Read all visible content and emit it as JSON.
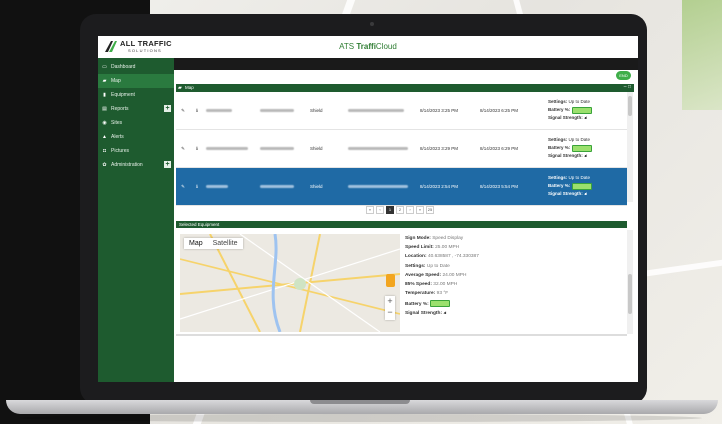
{
  "header": {
    "logo_text": "ALL TRAFFIC",
    "logo_sub": "SOLUTIONS",
    "app_title_prefix": "ATS ",
    "app_title_bold": "Traffi",
    "app_title_suffix": "Cloud"
  },
  "sidebar": {
    "items": [
      {
        "label": "Dashboard",
        "icon": "monitor-icon",
        "glyph": "▭"
      },
      {
        "label": "Map",
        "icon": "map-icon",
        "glyph": "▰",
        "active": true
      },
      {
        "label": "Equipment",
        "icon": "equipment-icon",
        "glyph": "▮"
      },
      {
        "label": "Reports",
        "icon": "reports-icon",
        "glyph": "▤",
        "expandable": true
      },
      {
        "label": "Sites",
        "icon": "location-icon",
        "glyph": "◉"
      },
      {
        "label": "Alerts",
        "icon": "alert-icon",
        "glyph": "▲"
      },
      {
        "label": "Pictures",
        "icon": "camera-icon",
        "glyph": "◘"
      },
      {
        "label": "Administration",
        "icon": "gear-icon",
        "glyph": "✿",
        "expandable": true
      }
    ],
    "expand_glyph": "+"
  },
  "main": {
    "end_button": "END",
    "map_panel_title": "Map",
    "map_panel_controls": "– □",
    "rows": [
      {
        "type": "Shield",
        "start": "8/14/2023 3:25 PM",
        "end": "8/14/2023 6:25 PM",
        "settings_label": "Settings:",
        "settings_value": "Up to Date",
        "battery_label": "Battery %:",
        "signal_label": "Signal Strength:",
        "selected": false
      },
      {
        "type": "Shield",
        "start": "8/14/2023 3:29 PM",
        "end": "8/14/2023 6:29 PM",
        "settings_label": "Settings:",
        "settings_value": "Up to Date",
        "battery_label": "Battery %:",
        "signal_label": "Signal Strength:",
        "selected": false
      },
      {
        "type": "Shield",
        "start": "8/14/2023 2:54 PM",
        "end": "8/14/2023 5:54 PM",
        "settings_label": "Settings:",
        "settings_value": "Up to Date",
        "battery_label": "Battery %:",
        "signal_label": "Signal Strength:",
        "selected": true
      }
    ],
    "pager": {
      "first": "«",
      "prev": "‹",
      "current": "1",
      "next_page": "2",
      "next": "›",
      "last": "»",
      "page_size": "25"
    },
    "selected_panel_title": "Selected Equipment",
    "map_tabs": {
      "map": "Map",
      "satellite": "Satellite"
    },
    "zoom_in": "+",
    "zoom_out": "−",
    "details": {
      "sign_mode_label": "Sign Mode:",
      "sign_mode": "Speed Display",
      "speed_limit_label": "Speed Limit:",
      "speed_limit": "25.00 MPH",
      "location_label": "Location:",
      "location": "40.638587 , -74.330387",
      "settings_label": "Settings:",
      "settings": "Up to Date",
      "avg_speed_label": "Average Speed:",
      "avg_speed": "24.00 MPH",
      "p85_label": "85% Speed:",
      "p85": "32.00 MPH",
      "temp_label": "Temperature:",
      "temp": "93 °F",
      "battery_label": "Battery %:",
      "signal_label": "Signal Strength:"
    }
  },
  "colors": {
    "brand_green": "#1e5b2f",
    "selected_row": "#1f6aa5",
    "end_button": "#3fae49"
  }
}
